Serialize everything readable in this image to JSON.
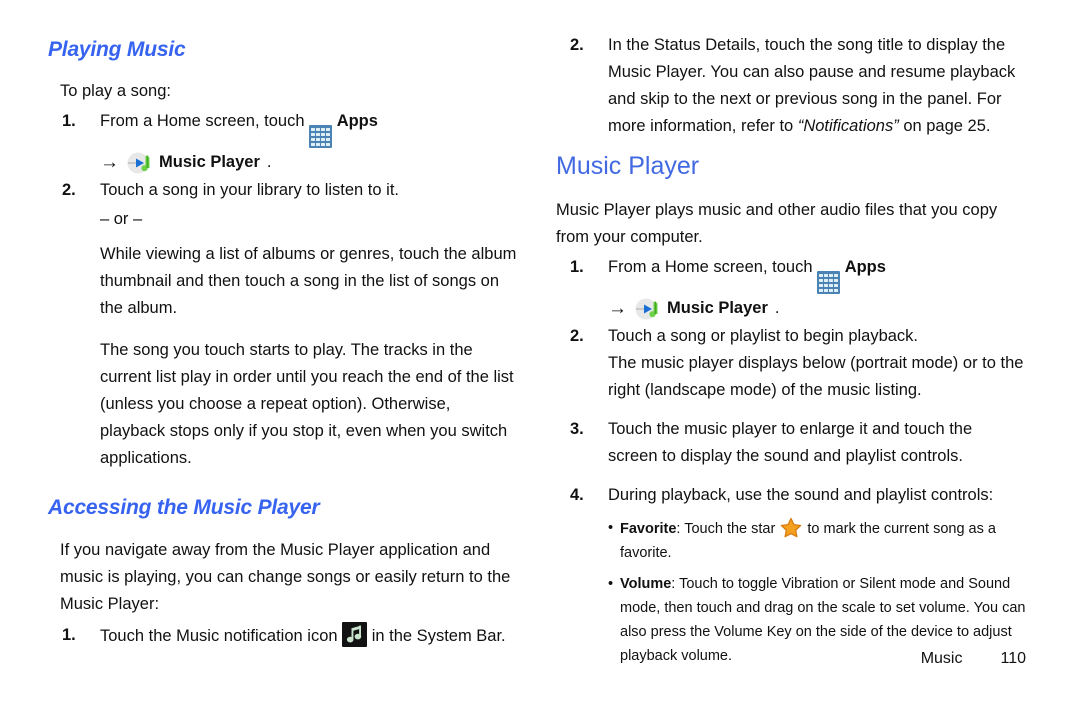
{
  "left_column": {
    "section_heading": "Playing Music",
    "intro": "To play a song:",
    "steps": [
      {
        "num": "1.",
        "text_before_icon": "From a Home screen, touch",
        "apps_label": "Apps",
        "substep_arrow": "→",
        "substep_label": "Music Player",
        "substep_period": "."
      },
      {
        "num": "2.",
        "text": "Touch a song in your library to listen to it."
      }
    ],
    "or_divider": "– or –",
    "paragraph_alt": "While viewing a list of albums or genres, touch the album thumbnail and then touch a song in the list of songs on the album.",
    "paragraph_result": "The song you touch starts to play. The tracks in the current list play in order until you reach the end of the list (unless you choose a repeat option). Otherwise, playback stops only if you stop it, even when you switch applications.",
    "section_heading_2": "Accessing the Music Player",
    "paragraph_accessing": "If you navigate away from the Music Player application and music is playing, you can change songs or easily return to the Music Player:",
    "step_notification": {
      "num": "1.",
      "text_before_icon": "Touch the Music notification icon",
      "text_after_icon": "in the System Bar."
    }
  },
  "right_column": {
    "step_2_continued": {
      "num": "2.",
      "text_part1": "In the Status Details, touch the song title to display the Music Player. You can also pause and resume playback and skip to the next or previous song in the panel. For more information, refer to",
      "reference": "“Notifications”",
      "text_part2": "on page 25."
    },
    "main_heading": "Music Player",
    "intro": "Music Player plays music and other audio files that you copy from your computer.",
    "steps": [
      {
        "num": "1.",
        "text_before_icon": "From a Home screen, touch",
        "apps_label": "Apps",
        "substep_arrow": "→",
        "substep_label": "Music Player",
        "substep_period": "."
      },
      {
        "num": "2.",
        "text": "Touch a song or playlist to begin playback.",
        "continuation": "The music player displays below (portrait mode) or to the right (landscape mode) of the music listing."
      },
      {
        "num": "3.",
        "text": "Touch the music player to enlarge it and touch the screen to display the sound and playlist controls."
      },
      {
        "num": "4.",
        "text": "During playback, use the sound and playlist controls:"
      }
    ],
    "bullets": [
      {
        "dot": "•",
        "label": "Favorite",
        "separator": ":",
        "text_before_icon": "Touch the star",
        "text_after_icon": "to mark the current song as a favorite."
      },
      {
        "dot": "•",
        "label": "Volume",
        "separator": ":",
        "text": "Touch to toggle Vibration or Silent mode and Sound mode, then touch and drag on the scale to set volume. You can also press the Volume Key on the side of the device to adjust playback volume."
      }
    ]
  },
  "footer": {
    "chapter": "Music",
    "page_number": "110"
  },
  "colors": {
    "section_heading_blue": "#3663f0",
    "main_heading_blue": "#4169e1",
    "apps_icon_blue": "#4b83b5",
    "star_orange": "#f29111",
    "note_green": "#c9e3cd",
    "body_text": "#111111"
  }
}
